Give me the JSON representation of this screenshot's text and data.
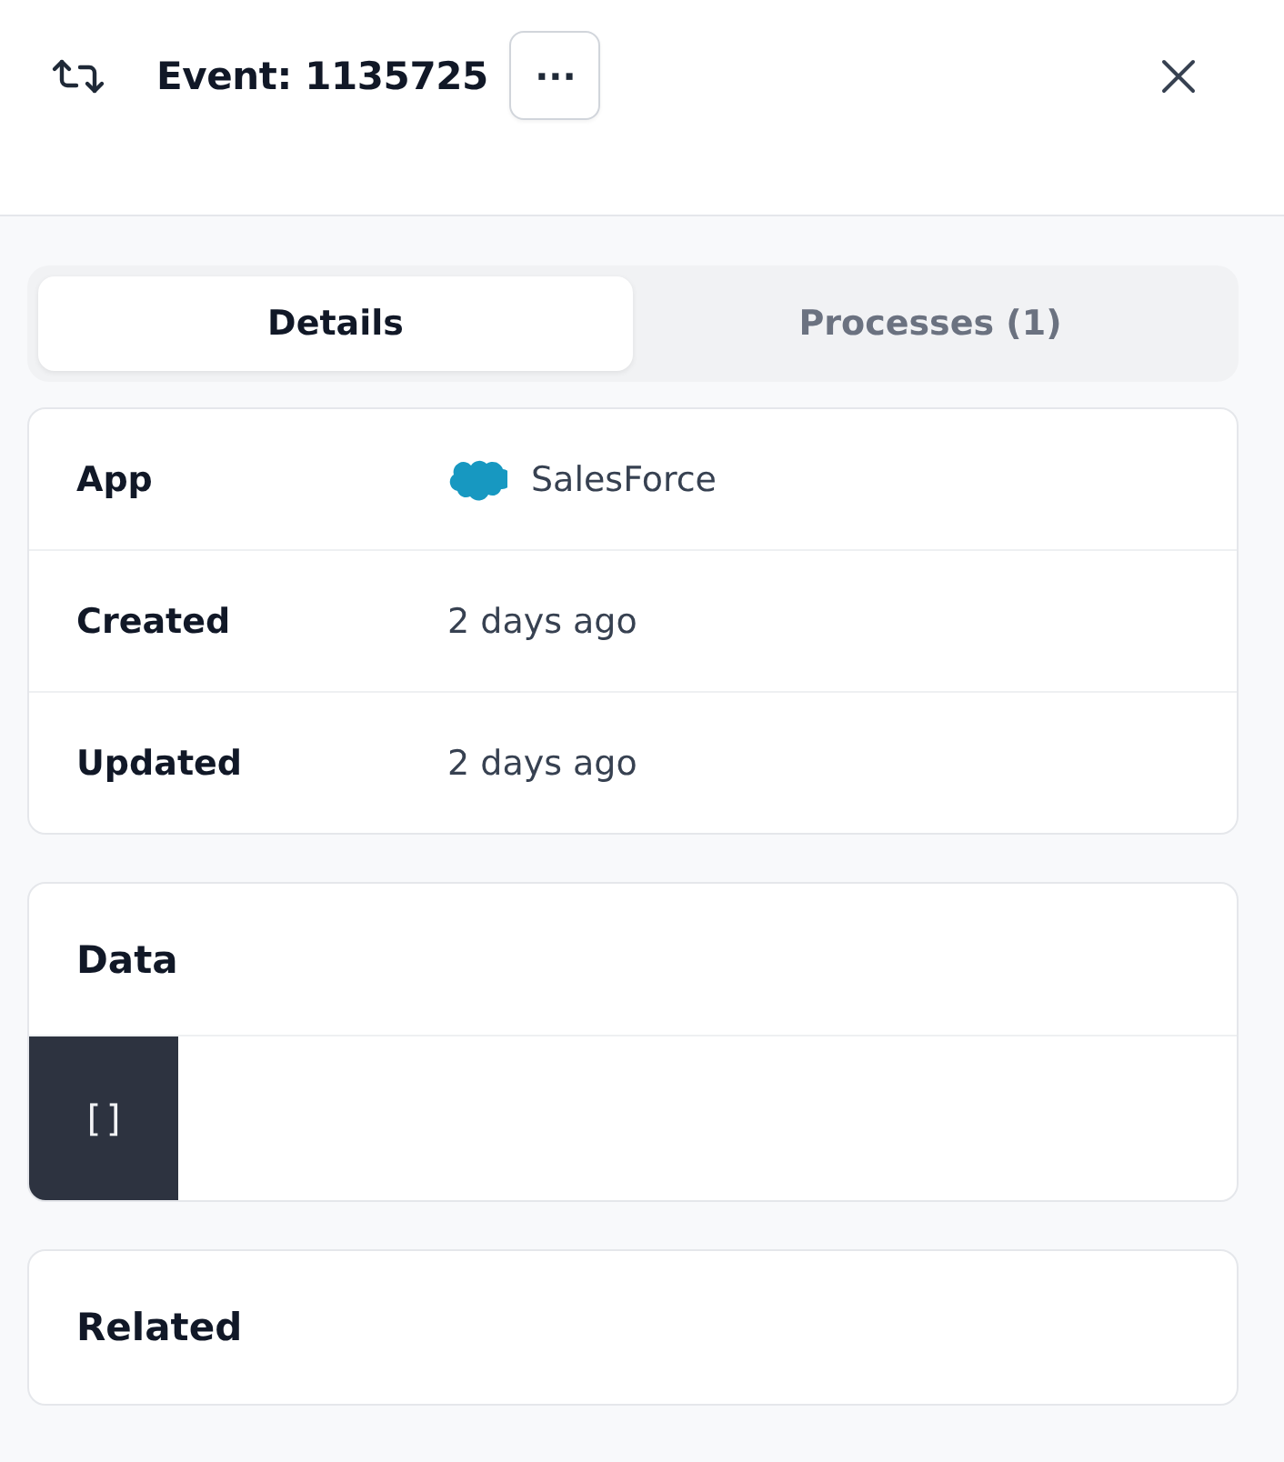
{
  "header": {
    "title": "Event: 1135725",
    "more_button": "···"
  },
  "tabs": [
    {
      "label": "Details",
      "selected": true
    },
    {
      "label": "Processes (1)",
      "selected": false
    }
  ],
  "details": [
    {
      "label": "App",
      "value": "SalesForce",
      "kind": "app"
    },
    {
      "label": "Created",
      "value": "2 days ago",
      "kind": "text"
    },
    {
      "label": "Updated",
      "value": "2 days ago",
      "kind": "text"
    }
  ],
  "data_section": {
    "title": "Data",
    "code": "[]"
  },
  "related_section": {
    "title": "Related"
  }
}
